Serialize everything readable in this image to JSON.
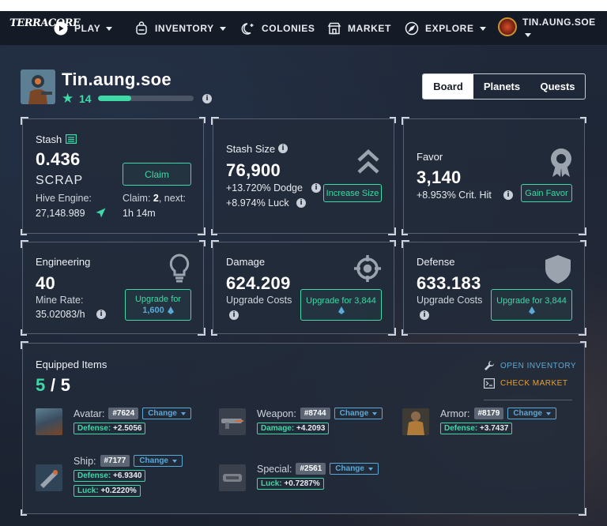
{
  "brand": {
    "logo_text": "TERRACORE"
  },
  "nav": {
    "items": [
      {
        "label": "PLAY",
        "icon": "play-circle-icon",
        "dropdown": true
      },
      {
        "label": "INVENTORY",
        "icon": "backpack-icon",
        "dropdown": true
      },
      {
        "label": "COLONIES",
        "icon": "moon-sparkle-icon",
        "dropdown": false
      },
      {
        "label": "MARKET",
        "icon": "store-icon",
        "dropdown": false
      },
      {
        "label": "EXPLORE",
        "icon": "compass-icon",
        "dropdown": true
      }
    ],
    "user": {
      "name": "TIN.AUNG.SOE"
    }
  },
  "profile": {
    "name": "Tin.aung.soe",
    "level": "14",
    "xp_progress": 0.35
  },
  "tabs": [
    "Board",
    "Planets",
    "Quests"
  ],
  "active_tab": "Board",
  "stash": {
    "title": "Stash",
    "amount": "0.436",
    "currency": "SCRAP",
    "hive_label": "Hive Engine:",
    "hive_value": "27,148.989",
    "claim_button": "Claim",
    "claim_label": "Claim:",
    "claim_count": "2",
    "claim_next_label": ", next:",
    "claim_next_time": "1h 14m"
  },
  "stash_size": {
    "title": "Stash Size",
    "value": "76,900",
    "dodge": "+13.720% Dodge",
    "luck": "+8.974% Luck",
    "button": "Increase Size"
  },
  "favor": {
    "title": "Favor",
    "value": "3,140",
    "crit": "+8.953% Crit. Hit",
    "button": "Gain Favor"
  },
  "engineering": {
    "title": "Engineering",
    "value": "40",
    "rate_label": "Mine Rate:",
    "rate_value": "35.02083/h",
    "button_line1": "Upgrade for",
    "button_line2": "1,600"
  },
  "damage": {
    "title": "Damage",
    "value": "624.209",
    "costs_label": "Upgrade Costs",
    "button_line1": "Upgrade for 3,844"
  },
  "defense": {
    "title": "Defense",
    "value": "633.183",
    "costs_label": "Upgrade Costs",
    "button_line1": "Upgrade for 3,844"
  },
  "equipped": {
    "title": "Equipped Items",
    "count": "5",
    "total": "5",
    "open_inventory": "OPEN INVENTORY",
    "check_market": "CHECK MARKET",
    "change_label": "Change",
    "items": [
      {
        "slot": "Avatar:",
        "id": "#7624",
        "stats": [
          {
            "key": "Defense:",
            "value": "+2.5056"
          }
        ]
      },
      {
        "slot": "Weapon:",
        "id": "#8744",
        "stats": [
          {
            "key": "Damage:",
            "value": "+4.2093"
          }
        ]
      },
      {
        "slot": "Armor:",
        "id": "#8179",
        "stats": [
          {
            "key": "Defense:",
            "value": "+3.7437"
          }
        ]
      },
      {
        "slot": "Ship:",
        "id": "#7177",
        "stats": [
          {
            "key": "Defense:",
            "value": "+6.9340"
          },
          {
            "key": "Luck:",
            "value": "+0.2220%"
          }
        ]
      },
      {
        "slot": "Special:",
        "id": "#2561",
        "stats": [
          {
            "key": "Luck:",
            "value": "+0.7287%"
          }
        ]
      }
    ]
  },
  "colors": {
    "accent": "#3ed9a6",
    "link_blue": "#5aa9d6",
    "link_orange": "#e3a03a",
    "background": "#1b2331"
  }
}
